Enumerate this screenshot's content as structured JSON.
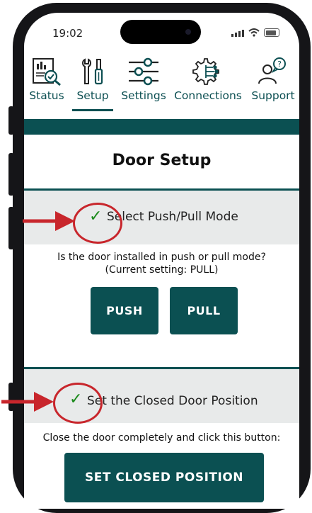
{
  "status_bar": {
    "time": "19:02"
  },
  "nav": {
    "items": [
      {
        "label": "Status",
        "icon": "status-report-icon"
      },
      {
        "label": "Setup",
        "icon": "tools-icon",
        "active": true
      },
      {
        "label": "Settings",
        "icon": "sliders-icon"
      },
      {
        "label": "Connections",
        "icon": "gear-network-icon"
      },
      {
        "label": "Support",
        "icon": "support-person-icon"
      }
    ]
  },
  "page": {
    "title": "Door Setup"
  },
  "sections": [
    {
      "heading": "Select Push/Pull Mode",
      "checked": true,
      "description": "Is the door installed in push or pull mode?",
      "current_setting": "(Current setting: PULL)",
      "buttons": [
        "PUSH",
        "PULL"
      ]
    },
    {
      "heading": "Set the Closed Door Position",
      "checked": true,
      "description": "Close the door completely and click this button:",
      "buttons": [
        "SET CLOSED POSITION"
      ]
    }
  ],
  "colors": {
    "accent": "#0b5052",
    "check": "#1a8a1a",
    "annotation": "#c8262c"
  }
}
